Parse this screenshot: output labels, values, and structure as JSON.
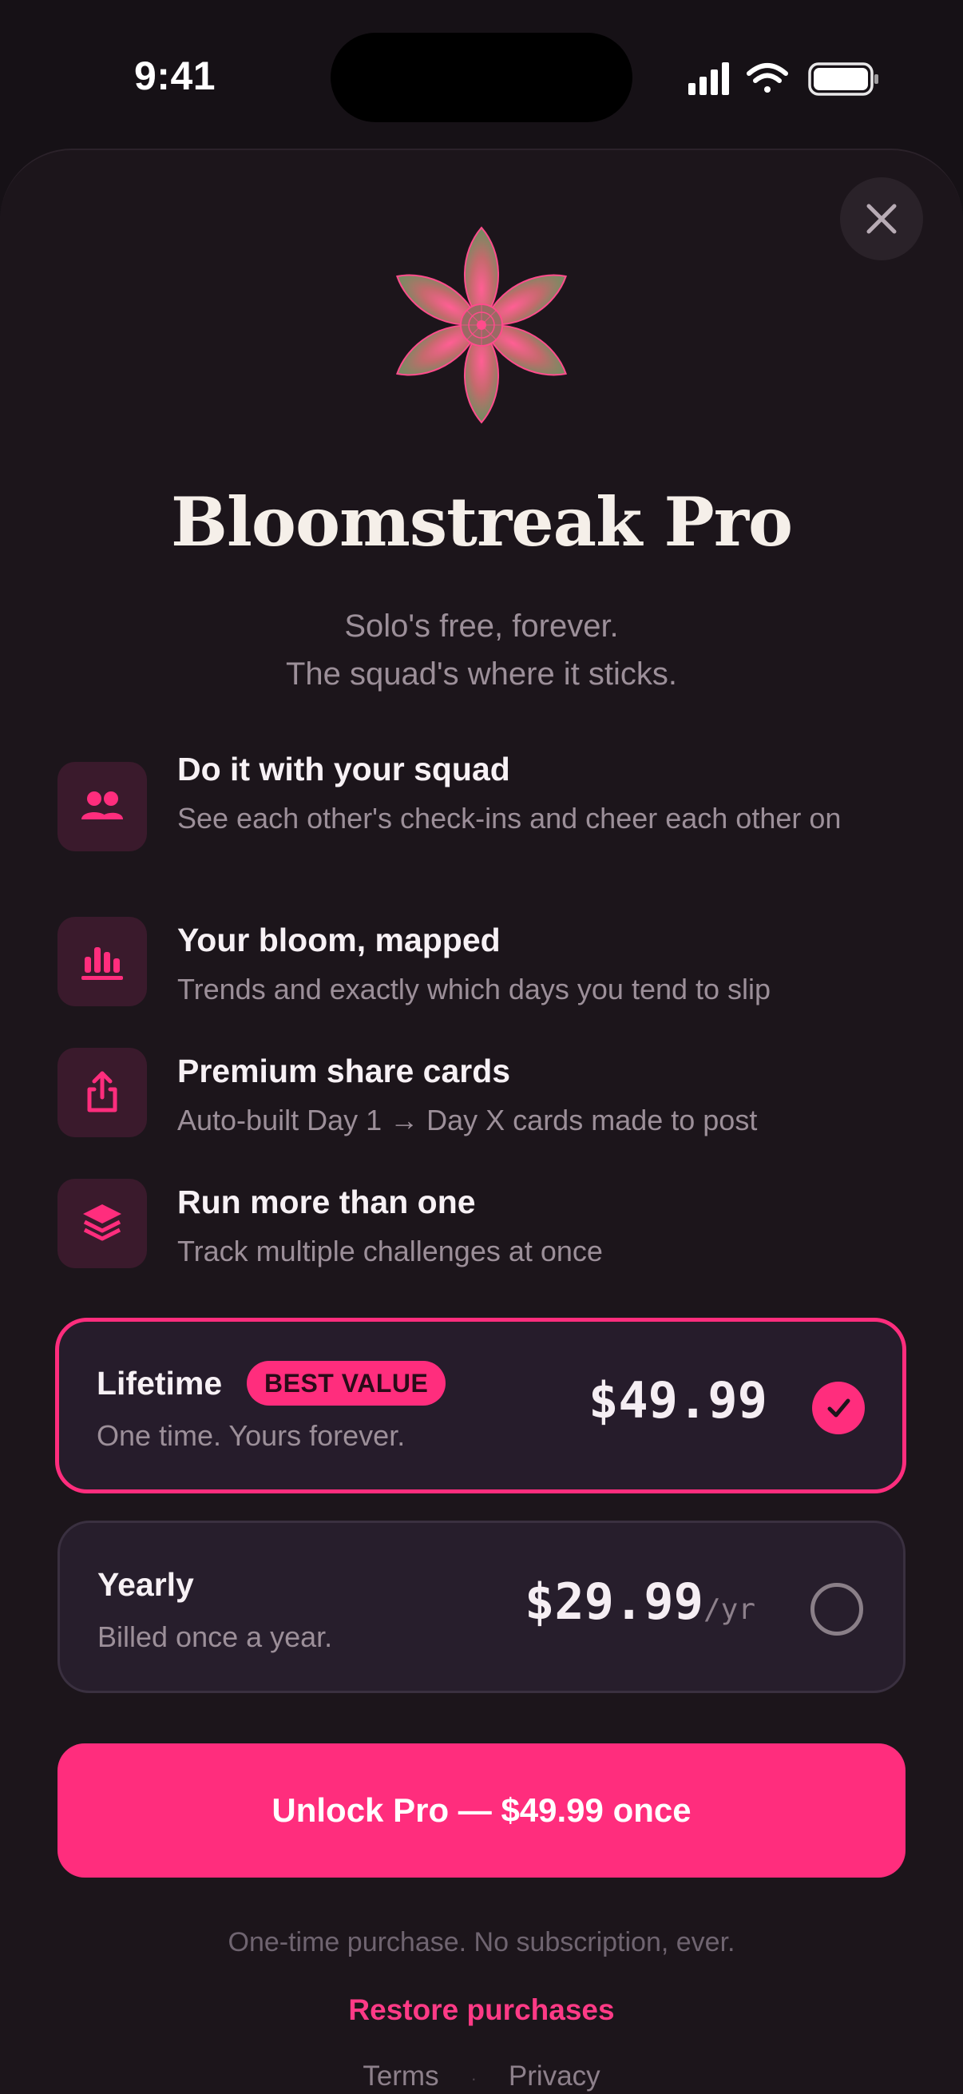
{
  "status_bar": {
    "time": "9:41"
  },
  "header": {
    "title": "Bloomstreak Pro",
    "subtitle_line1": "Solo's free, forever.",
    "subtitle_line2": "The squad's where it sticks."
  },
  "features": [
    {
      "icon": "group-icon",
      "title": "Do it with your squad",
      "desc": "See each other's check-ins and cheer each other on"
    },
    {
      "icon": "bar-chart-icon",
      "title": "Your bloom, mapped",
      "desc": "Trends and exactly which days you tend to slip"
    },
    {
      "icon": "share-icon",
      "title": "Premium share cards",
      "desc": "Auto-built Day 1 → Day X cards made to post"
    },
    {
      "icon": "layers-icon",
      "title": "Run more than one",
      "desc": "Track multiple challenges at once"
    }
  ],
  "plans": [
    {
      "name": "Lifetime",
      "badge": "BEST VALUE",
      "desc": "One time. Yours forever.",
      "price": "$49.99",
      "selected": true
    },
    {
      "name": "Yearly",
      "desc": "Billed once a year.",
      "price": "$29.99",
      "period": "/yr",
      "selected": false
    }
  ],
  "cta": {
    "label": "Unlock Pro — $49.99 once"
  },
  "footer": {
    "note": "One-time purchase. No subscription, ever.",
    "restore": "Restore purchases",
    "terms": "Terms",
    "separator": "·",
    "privacy": "Privacy"
  },
  "colors": {
    "accent": "#ff2d7d",
    "background": "#161116",
    "sheet": "#1c151b",
    "card": "#271e2c"
  }
}
